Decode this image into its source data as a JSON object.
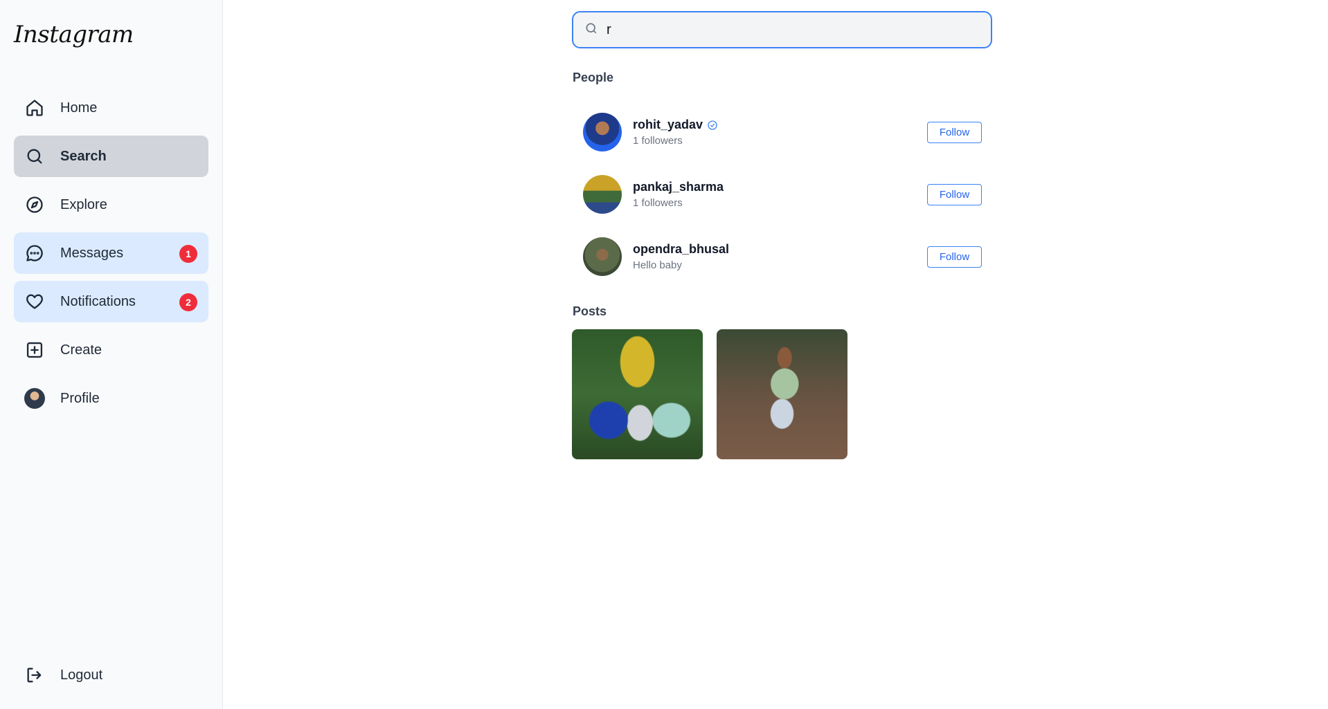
{
  "app": {
    "logo": "Instagram"
  },
  "sidebar": {
    "items": [
      {
        "label": "Home",
        "icon": "home-icon"
      },
      {
        "label": "Search",
        "icon": "search-icon",
        "active": true
      },
      {
        "label": "Explore",
        "icon": "compass-icon"
      },
      {
        "label": "Messages",
        "icon": "message-icon",
        "badge": "1"
      },
      {
        "label": "Notifications",
        "icon": "heart-icon",
        "badge": "2"
      },
      {
        "label": "Create",
        "icon": "plus-square-icon"
      },
      {
        "label": "Profile",
        "icon": "avatar"
      }
    ],
    "logout": {
      "label": "Logout",
      "icon": "logout-icon"
    }
  },
  "search": {
    "value": "r",
    "placeholder": ""
  },
  "people": {
    "title": "People",
    "items": [
      {
        "username": "rohit_yadav",
        "subtitle": "1 followers",
        "verified": true,
        "action": "Follow"
      },
      {
        "username": "pankaj_sharma",
        "subtitle": "1 followers",
        "verified": false,
        "action": "Follow"
      },
      {
        "username": "opendra_bhusal",
        "subtitle": "Hello baby",
        "verified": false,
        "action": "Follow"
      }
    ]
  },
  "posts": {
    "title": "Posts",
    "count": 2
  },
  "colors": {
    "accent": "#3b82f6",
    "badge": "#ef2c3a",
    "active_bg": "#d1d5db",
    "highlight_bg": "#dbeafe"
  }
}
